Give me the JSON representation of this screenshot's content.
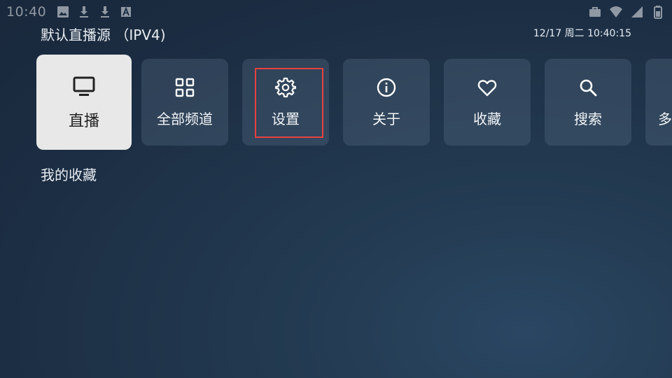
{
  "status_bar": {
    "time": "10:40",
    "left_icons": [
      "image-icon",
      "download-icon",
      "download-icon",
      "font-icon"
    ],
    "right_icons": [
      "briefcase-icon",
      "wifi-icon",
      "signal-icon",
      "battery-icon"
    ]
  },
  "header": {
    "title": "默认直播源 （IPV4)",
    "datetime": "12/17 周二 10:40:15"
  },
  "menu": {
    "items": [
      {
        "label": "直播",
        "icon": "tv-icon"
      },
      {
        "label": "全部频道",
        "icon": "grid-icon"
      },
      {
        "label": "设置",
        "icon": "gear-icon"
      },
      {
        "label": "关于",
        "icon": "info-icon"
      },
      {
        "label": "收藏",
        "icon": "heart-icon"
      },
      {
        "label": "搜索",
        "icon": "search-icon"
      },
      {
        "label": "多",
        "icon": ""
      }
    ]
  },
  "favorites": {
    "label": "我的收藏"
  },
  "colors": {
    "highlight": "#e8413f",
    "active_tile": "#e8e8e8"
  }
}
